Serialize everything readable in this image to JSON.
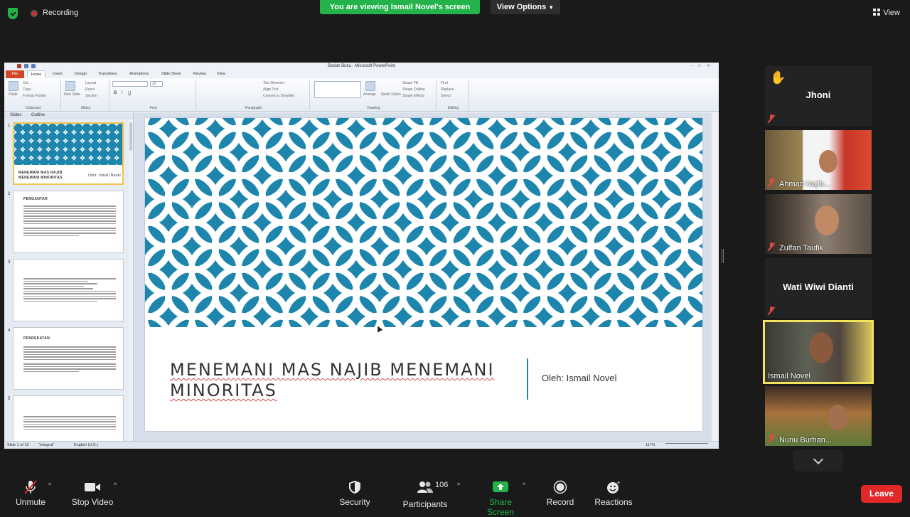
{
  "top_bar": {
    "recording_label": "Recording",
    "viewing_banner": "You are viewing Ismail Novel's screen",
    "view_options_label": "View Options",
    "view_label": "View"
  },
  "ppt": {
    "window_title": "Bedah Buku - Microsoft PowerPoint",
    "tabs": [
      "File",
      "Home",
      "Insert",
      "Design",
      "Transitions",
      "Animations",
      "Slide Show",
      "Review",
      "View"
    ],
    "ribbon": {
      "clipboard": {
        "label": "Clipboard",
        "paste": "Paste",
        "cut": "Cut",
        "copy": "Copy",
        "format_painter": "Format Painter"
      },
      "slides": {
        "label": "Slides",
        "new_slide": "New Slide",
        "layout": "Layout",
        "reset": "Reset",
        "section": "Section"
      },
      "font": {
        "label": "Font",
        "size": "22"
      },
      "paragraph": {
        "label": "Paragraph",
        "text_direction": "Text Direction",
        "align_text": "Align Text",
        "smartart": "Convert to SmartArt"
      },
      "drawing": {
        "label": "Drawing",
        "arrange": "Arrange",
        "quick_styles": "Quick Styles",
        "shape_fill": "Shape Fill",
        "shape_outline": "Shape Outline",
        "shape_effects": "Shape Effects"
      },
      "editing": {
        "label": "Editing",
        "find": "Find",
        "replace": "Replace",
        "select": "Select"
      }
    },
    "panel_tabs": [
      "Slides",
      "Outline"
    ],
    "thumbnails": [
      {
        "num": "1",
        "title": "MENEMANI MAS NAJIB MENEMANI MINORITAS",
        "subtitle": "Oleh: Ismail Novel"
      },
      {
        "num": "2",
        "title": "PENGANTAR"
      },
      {
        "num": "3",
        "title": ""
      },
      {
        "num": "4",
        "title": "PENDEKATAN."
      },
      {
        "num": "5",
        "title": ""
      }
    ],
    "slide": {
      "title": "MENEMANI MAS NAJIB MENEMANI MINORITAS",
      "author": "Oleh: Ismail Novel"
    },
    "status": {
      "slide_of": "Slide 1 of 10",
      "theme": "\"Integral\"",
      "language": "English (U.S.)",
      "zoom": "117%"
    },
    "colors": {
      "accent": "#1e86ad"
    }
  },
  "participants": [
    {
      "name": "Jhoni",
      "video": false,
      "hand_raised": true,
      "muted": true
    },
    {
      "name": "Ahmad Najib...",
      "video": true,
      "muted": true
    },
    {
      "name": "Zulfan Taufik",
      "video": true,
      "muted": true
    },
    {
      "name": "Wati Wiwi Dianti",
      "video": false,
      "muted": true
    },
    {
      "name": "Ismail Novel",
      "video": true,
      "muted": false,
      "active_speaker": true
    },
    {
      "name": "Nunu Burhan...",
      "video": true,
      "muted": true
    }
  ],
  "toolbar": {
    "unmute": "Unmute",
    "stop_video": "Stop Video",
    "security": "Security",
    "participants": "Participants",
    "participants_count": "106",
    "share_screen": "Share Screen",
    "record": "Record",
    "reactions": "Reactions",
    "leave": "Leave"
  }
}
